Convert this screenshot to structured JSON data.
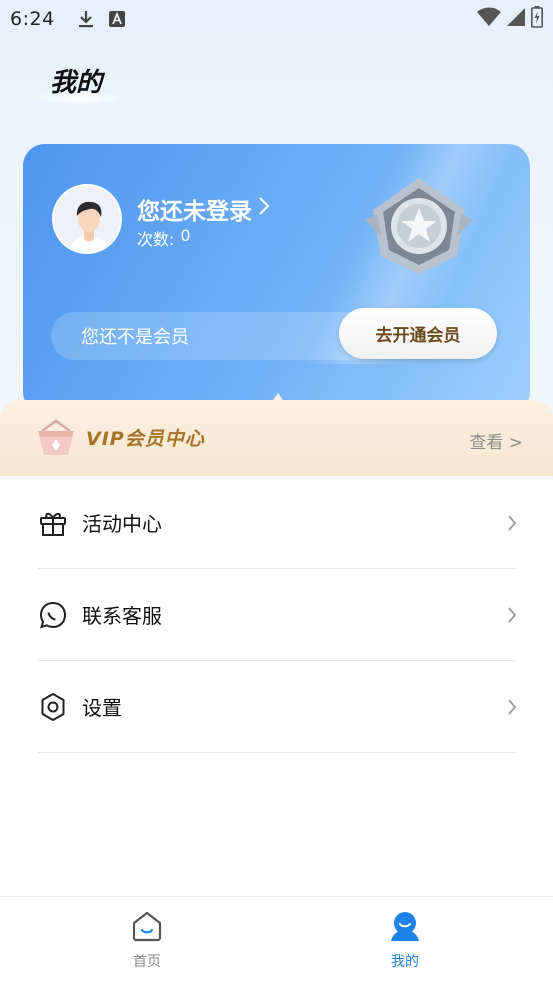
{
  "status_bar": {
    "time": "6:24",
    "icons": [
      "download-icon",
      "text-a-icon",
      "wifi-icon",
      "signal-icon",
      "battery-icon"
    ]
  },
  "page": {
    "title": "我的"
  },
  "member_card": {
    "login_title": "您还未登录",
    "count_label": "次数:",
    "count_value": "0",
    "member_status": "您还不是会员",
    "open_vip_label": "去开通会员",
    "accent_color": "#4d95ee"
  },
  "vip_center": {
    "title": "VIP会员中心",
    "view_label": "查看 >"
  },
  "menu": {
    "items": [
      {
        "label": "活动中心",
        "icon": "gift-icon"
      },
      {
        "label": "联系客服",
        "icon": "chat-icon"
      },
      {
        "label": "设置",
        "icon": "settings-icon"
      }
    ]
  },
  "bottom_nav": {
    "items": [
      {
        "label": "首页",
        "icon": "home-icon",
        "active": false
      },
      {
        "label": "我的",
        "icon": "profile-icon",
        "active": true
      }
    ],
    "active_color": "#1d83e8",
    "inactive_color": "#8a8a8a"
  }
}
